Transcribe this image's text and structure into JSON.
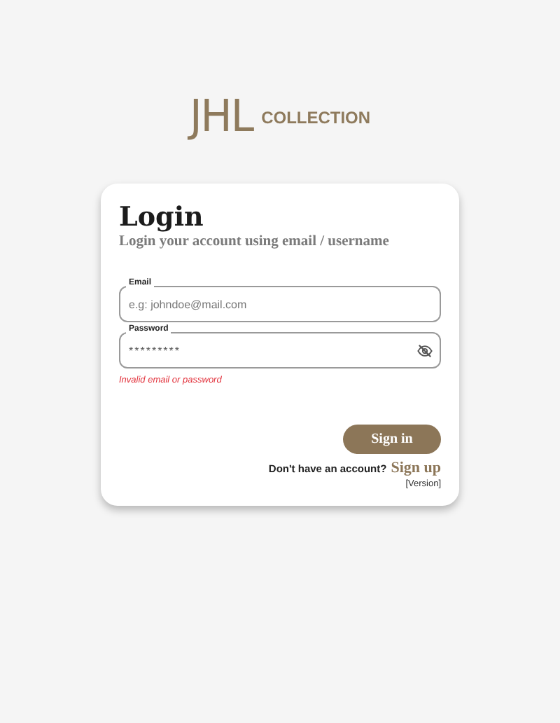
{
  "logo": {
    "mark": "JHL",
    "wordmark": "COLLECTION"
  },
  "card": {
    "title": "Login",
    "subtitle": "Login your account using email / username"
  },
  "fields": [
    {
      "label": "Email",
      "placeholder": "e.g: johndoe@mail.com",
      "kind": "text"
    },
    {
      "label": "Password",
      "value": "*********",
      "kind": "password"
    }
  ],
  "error": "Invalid email or password",
  "sign_in_button": "Sign in",
  "signup": {
    "prompt": "Don't have an account?",
    "link": "Sign up"
  },
  "version": "[Version]"
}
